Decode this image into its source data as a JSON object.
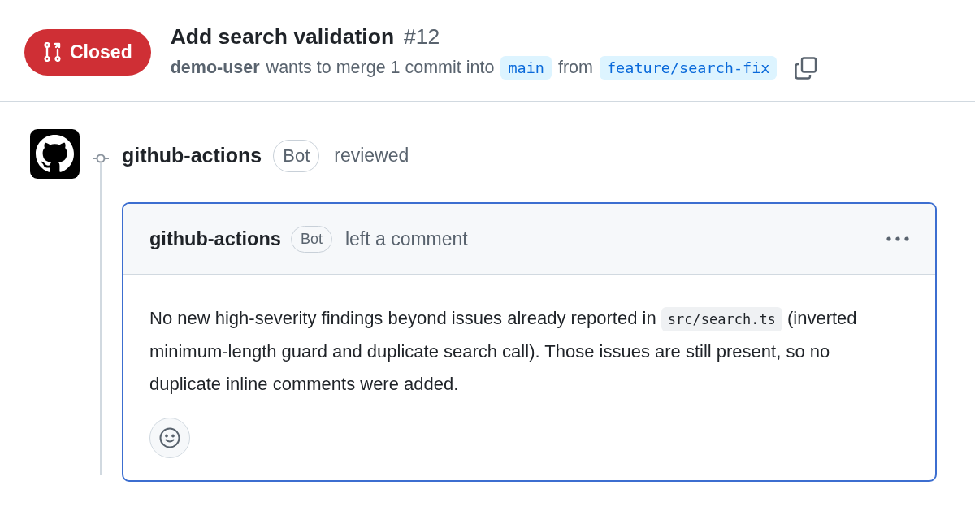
{
  "pull_request": {
    "status": {
      "kind": "closed",
      "label": "Closed"
    },
    "title": "Add search validation",
    "number": "#12",
    "author": "demo-user",
    "summary": "wants to merge 1 commit into",
    "base_branch": "main",
    "connector": "from",
    "head_branch": "feature/search-fix"
  },
  "timeline": [
    {
      "kind": "review",
      "actor": "github-actions",
      "badge": "Bot",
      "action": "reviewed",
      "comment": {
        "highlighted": true,
        "author": "github-actions",
        "badge": "Bot",
        "action": "left a comment",
        "body": [
          {
            "kind": "text",
            "text": "No new high-severity findings beyond issues already reported in "
          },
          {
            "kind": "code",
            "text": "src/search.ts"
          },
          {
            "kind": "text",
            "text": " (inverted minimum-length guard and duplicate search call). Those issues are still present, so no duplicate inline comments were added."
          }
        ]
      }
    }
  ]
}
